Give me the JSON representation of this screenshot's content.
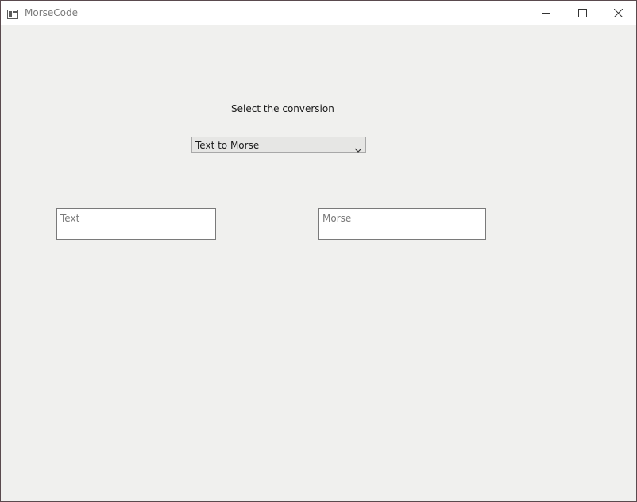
{
  "window": {
    "title": "MorseCode",
    "icons": {
      "app": "window-app-icon",
      "minimize": "minimize-icon",
      "maximize": "maximize-icon",
      "close": "close-icon"
    }
  },
  "main": {
    "heading": "Select the conversion",
    "conversion_select": {
      "selected": "Text to Morse",
      "icon": "chevron-down-icon"
    },
    "text_input": {
      "value": "",
      "placeholder": "Text"
    },
    "morse_output": {
      "value": "",
      "placeholder": "Morse"
    }
  },
  "colors": {
    "window_background": "#f0f0ee",
    "titlebar_background": "#ffffff",
    "title_text": "#7a7a7a",
    "combo_background": "#e6e6e4",
    "placeholder_text": "#7a7a7a"
  }
}
